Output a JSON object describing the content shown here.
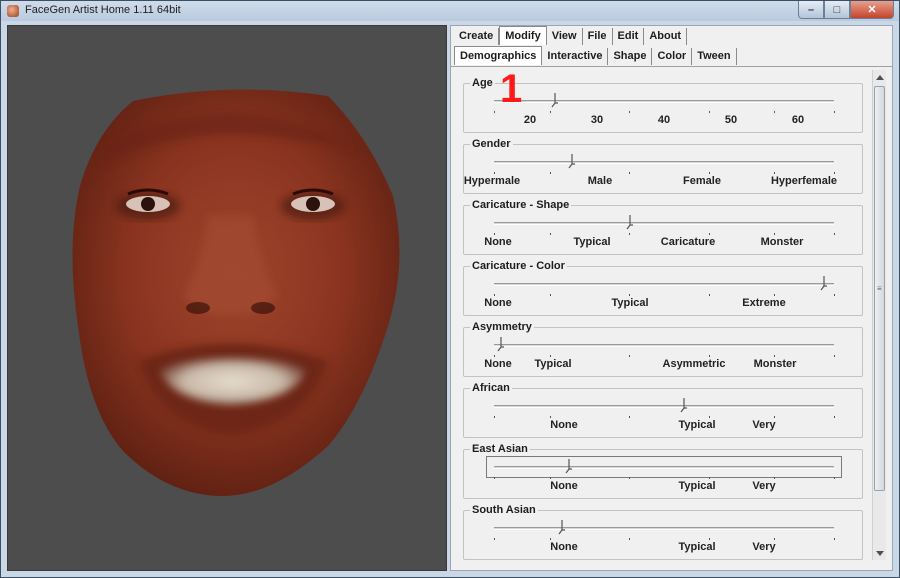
{
  "window": {
    "title": "FaceGen Artist Home 1.11 64bit",
    "accent": "#c4442c"
  },
  "tabs_top": [
    {
      "label": "Create"
    },
    {
      "label": "Modify"
    },
    {
      "label": "View"
    },
    {
      "label": "File"
    },
    {
      "label": "Edit"
    },
    {
      "label": "About"
    }
  ],
  "tabs_sub": [
    {
      "label": "Demographics"
    },
    {
      "label": "Interactive"
    },
    {
      "label": "Shape"
    },
    {
      "label": "Color"
    },
    {
      "label": "Tween"
    }
  ],
  "active_top": "Modify",
  "active_sub": "Demographics",
  "annotation_marker": "1",
  "groups": [
    {
      "title": "Age",
      "value_fraction": 0.18,
      "labels": [
        "20",
        "30",
        "40",
        "50",
        "60"
      ]
    },
    {
      "title": "Gender",
      "value_fraction": 0.23,
      "labels": [
        "Hypermale",
        "Male",
        "Female",
        "Hyperfemale"
      ]
    },
    {
      "title": "Caricature - Shape",
      "value_fraction": 0.4,
      "labels": [
        "None",
        "Typical",
        "Caricature",
        "Monster"
      ]
    },
    {
      "title": "Caricature - Color",
      "value_fraction": 0.97,
      "labels": [
        "None",
        "Typical",
        "Extreme"
      ]
    },
    {
      "title": "Asymmetry",
      "value_fraction": 0.02,
      "labels": [
        "None",
        "Typical",
        "Asymmetric",
        "Monster"
      ]
    },
    {
      "title": "African",
      "value_fraction": 0.56,
      "labels": [
        "None",
        "Typical",
        "Very"
      ]
    },
    {
      "title": "East Asian",
      "value_fraction": 0.22,
      "labels": [
        "None",
        "Typical",
        "Very"
      ]
    },
    {
      "title": "South Asian",
      "value_fraction": 0.2,
      "labels": [
        "None",
        "Typical",
        "Very"
      ]
    }
  ]
}
